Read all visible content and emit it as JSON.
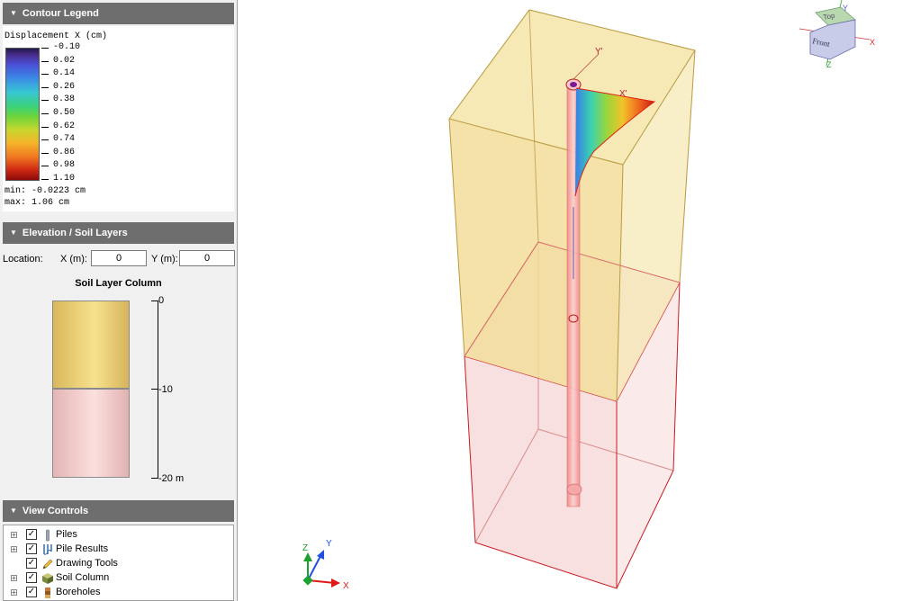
{
  "contour_legend": {
    "header": "Contour Legend",
    "title": "Displacement X (cm)",
    "ticks": [
      "-0.10",
      "0.02",
      "0.14",
      "0.26",
      "0.38",
      "0.50",
      "0.62",
      "0.74",
      "0.86",
      "0.98",
      "1.10"
    ],
    "min_text": "min: -0.0223 cm",
    "max_text": "max: 1.06 cm"
  },
  "elevation": {
    "header": "Elevation / Soil Layers",
    "location_label": "Location:",
    "x_label": "X (m):",
    "x_value": "0",
    "y_label": "Y (m):",
    "y_value": "0",
    "column_title": "Soil Layer Column",
    "axis_labels": [
      "0",
      "-10",
      "-20 m"
    ],
    "layer_colors": [
      "#f0d98a",
      "#f5cfcd"
    ]
  },
  "view_controls": {
    "header": "View Controls",
    "items": [
      {
        "label": "Piles",
        "icon": "pile-icon",
        "expandable": true,
        "checked": true
      },
      {
        "label": "Pile Results",
        "icon": "pile-results-icon",
        "expandable": true,
        "checked": true
      },
      {
        "label": "Drawing Tools",
        "icon": "pencil-icon",
        "expandable": false,
        "checked": true
      },
      {
        "label": "Soil Column",
        "icon": "soil-cube-icon",
        "expandable": true,
        "checked": true
      },
      {
        "label": "Boreholes",
        "icon": "borehole-icon",
        "expandable": true,
        "checked": true
      }
    ]
  },
  "viewport": {
    "local_axis_y": "Y'",
    "local_axis_x": "X'",
    "cube_top": "Top",
    "cube_front": "Front",
    "cube_axes": [
      "Y",
      "X",
      "Z"
    ],
    "triad_axes": [
      "Z",
      "Y",
      "X"
    ]
  }
}
